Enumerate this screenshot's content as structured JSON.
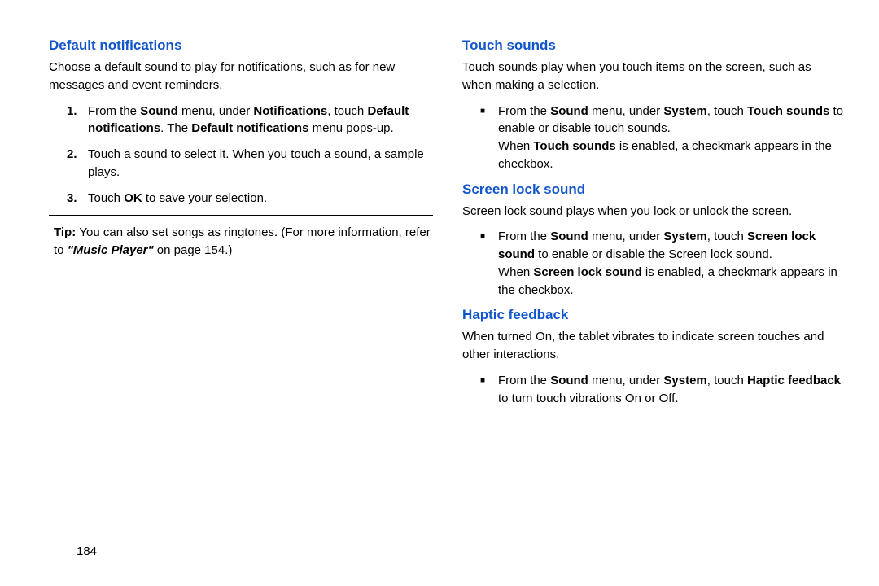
{
  "page_number": "184",
  "left": {
    "heading": "Default notifications",
    "intro": "Choose a default sound to play for notifications, such as for new messages and event reminders.",
    "steps": [
      {
        "num": "1.",
        "pre": "From the ",
        "b1": "Sound",
        "mid1": " menu, under ",
        "b2": "Notifications",
        "mid2": ", touch ",
        "b3": "Default notifications",
        "mid3": ". The ",
        "b4": "Default notifications",
        "post": " menu pops-up."
      },
      {
        "num": "2.",
        "text": "Touch a sound to select it. When you touch a sound, a sample plays."
      },
      {
        "num": "3.",
        "pre": "Touch ",
        "b1": "OK",
        "post": " to save your selection."
      }
    ],
    "tip_label": "Tip: ",
    "tip_body_pre": "You can also set songs as ringtones. (For more information, refer to ",
    "tip_ref": "\"Music Player\"",
    "tip_body_post": " on page 154.)"
  },
  "right": {
    "sec1": {
      "heading": "Touch sounds",
      "intro": "Touch sounds play when you touch items on the screen, such as when making a selection.",
      "bullet_pre": "From the ",
      "b1": "Sound",
      "mid1": " menu, under ",
      "b2": "System",
      "mid2": ", touch ",
      "b3": "Touch sounds",
      "post": " to enable or disable touch sounds.",
      "note_pre": "When ",
      "note_b": "Touch sounds",
      "note_post": " is enabled, a checkmark appears in the checkbox."
    },
    "sec2": {
      "heading": "Screen lock sound",
      "intro": "Screen lock sound plays when you lock or unlock the screen.",
      "bullet_pre": "From the ",
      "b1": "Sound",
      "mid1": " menu, under ",
      "b2": "System",
      "mid2": ", touch ",
      "b3": "Screen lock sound",
      "post": " to enable or disable the Screen lock sound.",
      "note_pre": "When ",
      "note_b": "Screen lock sound",
      "note_post": " is enabled, a checkmark appears in the checkbox."
    },
    "sec3": {
      "heading": "Haptic feedback",
      "intro": "When turned On, the tablet vibrates to indicate screen touches and other interactions.",
      "bullet_pre": "From the ",
      "b1": "Sound",
      "mid1": " menu, under ",
      "b2": "System",
      "mid2": ", touch ",
      "b3": "Haptic feedback",
      "post": " to turn touch vibrations On or Off."
    }
  }
}
